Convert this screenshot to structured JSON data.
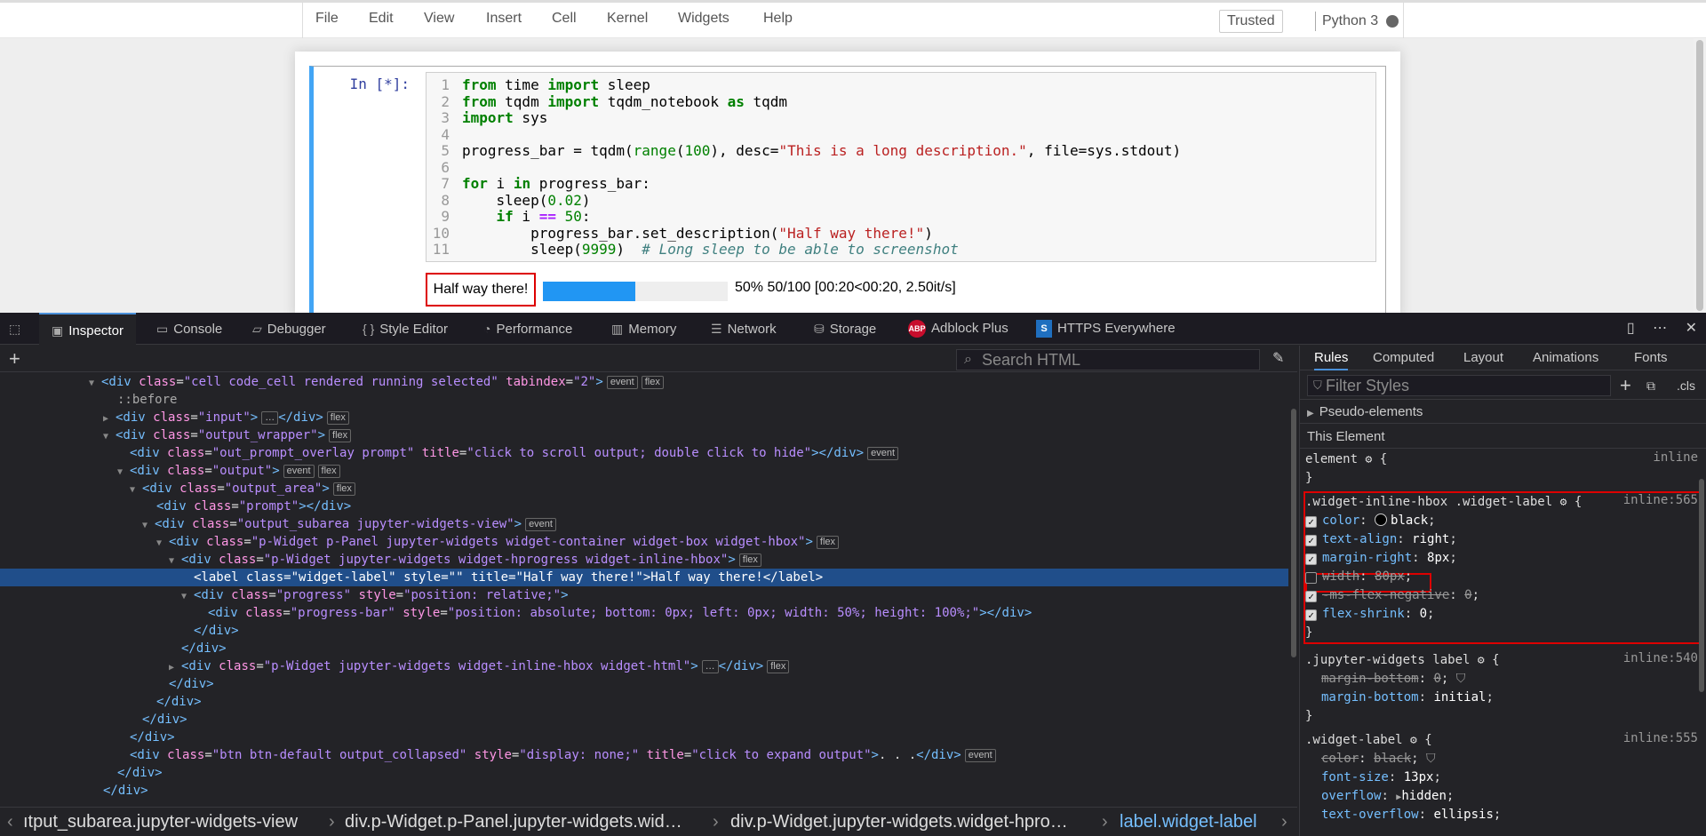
{
  "menubar": {
    "items": [
      "File",
      "Edit",
      "View",
      "Insert",
      "Cell",
      "Kernel",
      "Widgets",
      "Help"
    ],
    "trusted": "Trusted",
    "kernel": "Python 3"
  },
  "cell": {
    "prompt": "In [*]:",
    "line_numbers": [
      "1",
      "2",
      "3",
      "4",
      "5",
      "6",
      "7",
      "8",
      "9",
      "10",
      "11"
    ]
  },
  "output": {
    "label": "Half way there!",
    "progress": 0.5,
    "status": "50% 50/100 [00:20<00:20, 2.50it/s]"
  },
  "devtools": {
    "tabs": [
      "Inspector",
      "Console",
      "Debugger",
      "Style Editor",
      "Performance",
      "Memory",
      "Network",
      "Storage",
      "Adblock Plus",
      "HTTPS Everywhere"
    ],
    "abp_badge": "ABP",
    "https_badge": "S",
    "search_placeholder": "Search HTML",
    "breadcrumbs": [
      "ıtput_subarea.jupyter-widgets-view",
      "div.p-Widget.p-Panel.jupyter-widgets.wid…",
      "div.p-Widget.jupyter-widgets.widget-hpro…",
      "label.widget-label"
    ]
  },
  "rules": {
    "tabs": [
      "Rules",
      "Computed",
      "Layout",
      "Animations",
      "Fonts"
    ],
    "filter_placeholder": "Filter Styles",
    "cls": ".cls",
    "pseudo": "Pseudo-elements",
    "this_element": "This Element",
    "element_sel": "element",
    "inline": "inline",
    "rule1": {
      "selector": ".widget-inline-hbox .widget-label",
      "source": "inline:565"
    },
    "rule2": {
      "selector": ".jupyter-widgets label",
      "source": "inline:540"
    },
    "rule3": {
      "selector": ".widget-label",
      "source": "inline:555"
    }
  }
}
